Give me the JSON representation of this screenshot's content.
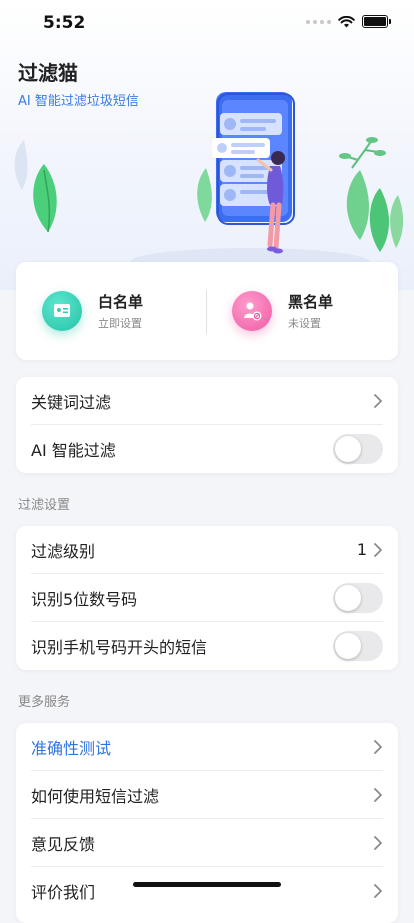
{
  "status_bar": {
    "time": "5:52"
  },
  "header": {
    "title": "过滤猫",
    "subtitle": "AI 智能过滤垃圾短信"
  },
  "lists": {
    "whitelist": {
      "name": "白名单",
      "status": "立即设置"
    },
    "blacklist": {
      "name": "黑名单",
      "status": "未设置"
    }
  },
  "main_options": {
    "keyword_filter": "关键词过滤",
    "ai_filter": "AI 智能过滤"
  },
  "filter_settings": {
    "section_title": "过滤设置",
    "level_label": "过滤级别",
    "level_value": "1",
    "five_digit_label": "识别5位数号码",
    "mobile_prefix_label": "识别手机号码开头的短信"
  },
  "more_services": {
    "section_title": "更多服务",
    "items": [
      {
        "label": "准确性测试"
      },
      {
        "label": "如何使用短信过滤"
      },
      {
        "label": "意见反馈"
      },
      {
        "label": "评价我们"
      }
    ]
  },
  "colors": {
    "accent": "#2f75e1",
    "whitelist_icon": "#2fcfb5",
    "blacklist_icon": "#f56fb0"
  },
  "toggles": {
    "ai_filter": false,
    "five_digit": false,
    "mobile_prefix": false
  }
}
